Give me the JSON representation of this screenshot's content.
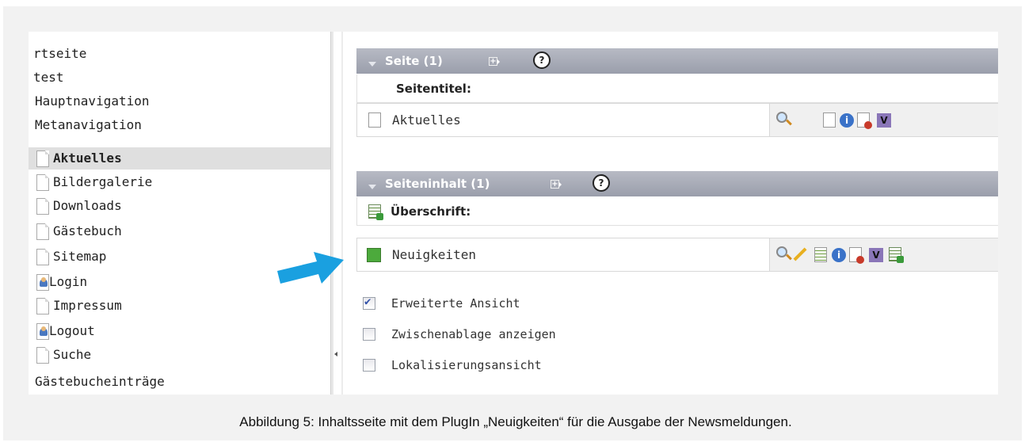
{
  "sidebar": {
    "items": [
      {
        "label": "rtseite"
      },
      {
        "label": "test"
      },
      {
        "label": "Hauptnavigation"
      },
      {
        "label": "Metanavigation"
      },
      {
        "label": "Aktuelles"
      },
      {
        "label": "Bildergalerie"
      },
      {
        "label": "Downloads"
      },
      {
        "label": "Gästebuch"
      },
      {
        "label": "Sitemap"
      },
      {
        "label": "Login"
      },
      {
        "label": "Impressum"
      },
      {
        "label": "Logout"
      },
      {
        "label": "Suche"
      },
      {
        "label": "Gästebucheinträge"
      }
    ]
  },
  "page_section": {
    "header": "Seite (1)",
    "field_label": "Seitentitel:",
    "item": "Aktuelles"
  },
  "content_section": {
    "header": "Seiteninhalt (1)",
    "field_label": "Überschrift:",
    "item": "Neuigkeiten"
  },
  "help_glyph": "?",
  "info_glyph": "i",
  "version_glyph": "V",
  "options": [
    {
      "label": "Erweiterte Ansicht",
      "checked": true
    },
    {
      "label": "Zwischenablage anzeigen",
      "checked": false
    },
    {
      "label": "Lokalisierungsansicht",
      "checked": false
    }
  ],
  "colors": {
    "section_bar": "#9a9eab",
    "arrow": "#1aa0e0",
    "active_row": "#dfdfdf"
  },
  "caption": "Abbildung 5: Inhaltsseite mit dem PlugIn „Neuigkeiten“ für die Ausgabe der Newsmeldungen."
}
